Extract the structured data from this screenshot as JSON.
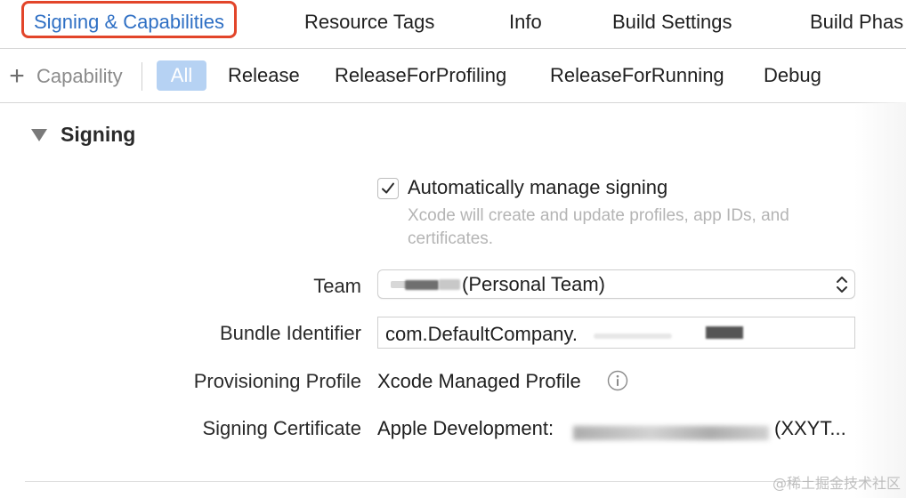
{
  "tabs": [
    {
      "label": "Signing & Capabilities",
      "active": true
    },
    {
      "label": "Resource Tags"
    },
    {
      "label": "Info"
    },
    {
      "label": "Build Settings"
    },
    {
      "label": "Build Phas"
    }
  ],
  "filterbar": {
    "add_capability_label": "Capability",
    "configs": [
      "All",
      "Release",
      "ReleaseForProfiling",
      "ReleaseForRunning",
      "Debug"
    ],
    "selected_config": "All"
  },
  "signing": {
    "section_title": "Signing",
    "auto_manage": {
      "checked": true,
      "label": "Automatically manage signing",
      "description": "Xcode will create and update profiles, app IDs, and certificates."
    },
    "team": {
      "label": "Team",
      "value": "(Personal Team)"
    },
    "bundle_identifier": {
      "label": "Bundle Identifier",
      "value": "com.DefaultCompany."
    },
    "provisioning_profile": {
      "label": "Provisioning Profile",
      "value": "Xcode Managed Profile"
    },
    "signing_certificate": {
      "label": "Signing Certificate",
      "value_prefix": "Apple Development:",
      "value_suffix": "(XXYT..."
    }
  },
  "watermark": "@稀土掘金技术社区",
  "colors": {
    "accent": "#2e6fc4",
    "highlight_border": "#e2452a",
    "pill_background": "#b6d2f3"
  },
  "icons": [
    "chevron-updown-icon",
    "info-icon",
    "checkmark-icon",
    "disclosure-triangle-icon",
    "plus-icon"
  ]
}
